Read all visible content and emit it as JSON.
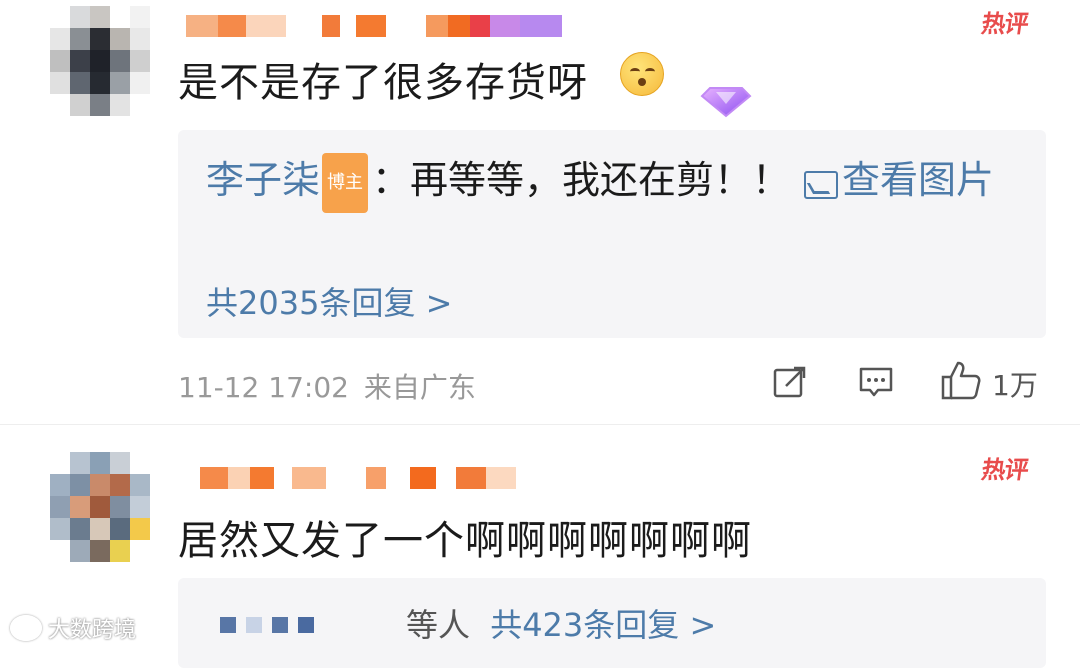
{
  "comments": [
    {
      "hot_badge": "热评",
      "text": "是不是存了很多存货呀",
      "reply": {
        "author": "李子柒",
        "author_badge": "博主",
        "separator": "：",
        "content": "再等等，我还在剪！！",
        "link_label": "查看图片",
        "count_text": "共2035条回复 >"
      },
      "meta": {
        "datetime": "11-12 17:02",
        "location": "来自广东"
      },
      "actions": {
        "share_icon": "share-icon",
        "comment_icon": "comment-icon",
        "like_icon": "thumbs-up-icon",
        "like_count": "1万"
      }
    },
    {
      "hot_badge": "热评",
      "text": "居然又发了一个啊啊啊啊啊啊啊",
      "reply": {
        "suffix": "等人",
        "count_text": "共423条回复 >"
      }
    }
  ],
  "watermark": "大数跨境",
  "colors": {
    "link_blue": "#4d7ba9",
    "hot_red": "#e84c4c",
    "reply_bg": "#f5f5f7",
    "meta_gray": "#999999"
  }
}
